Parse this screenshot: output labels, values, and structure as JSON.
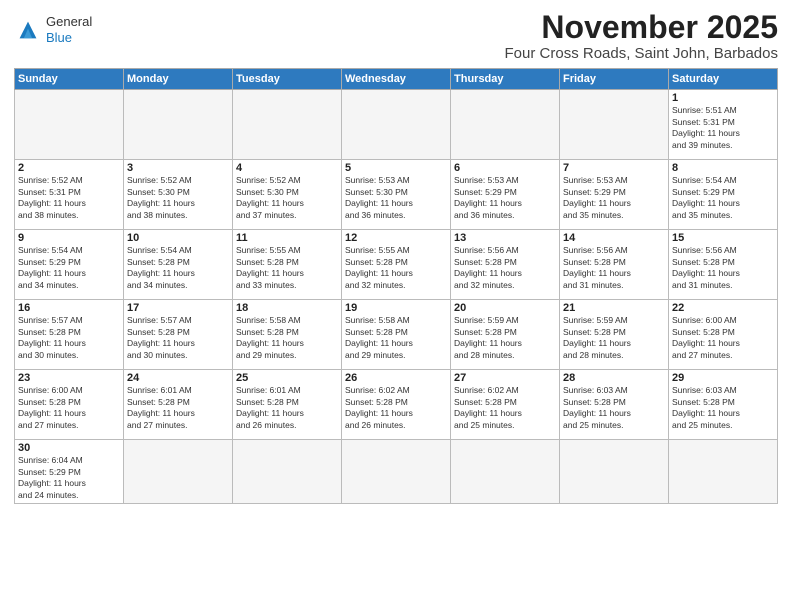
{
  "header": {
    "logo_general": "General",
    "logo_blue": "Blue",
    "month_year": "November 2025",
    "location": "Four Cross Roads, Saint John, Barbados"
  },
  "weekdays": [
    "Sunday",
    "Monday",
    "Tuesday",
    "Wednesday",
    "Thursday",
    "Friday",
    "Saturday"
  ],
  "weeks": [
    [
      {
        "day": "",
        "info": ""
      },
      {
        "day": "",
        "info": ""
      },
      {
        "day": "",
        "info": ""
      },
      {
        "day": "",
        "info": ""
      },
      {
        "day": "",
        "info": ""
      },
      {
        "day": "",
        "info": ""
      },
      {
        "day": "1",
        "info": "Sunrise: 5:51 AM\nSunset: 5:31 PM\nDaylight: 11 hours\nand 39 minutes."
      }
    ],
    [
      {
        "day": "2",
        "info": "Sunrise: 5:52 AM\nSunset: 5:31 PM\nDaylight: 11 hours\nand 38 minutes."
      },
      {
        "day": "3",
        "info": "Sunrise: 5:52 AM\nSunset: 5:30 PM\nDaylight: 11 hours\nand 38 minutes."
      },
      {
        "day": "4",
        "info": "Sunrise: 5:52 AM\nSunset: 5:30 PM\nDaylight: 11 hours\nand 37 minutes."
      },
      {
        "day": "5",
        "info": "Sunrise: 5:53 AM\nSunset: 5:30 PM\nDaylight: 11 hours\nand 36 minutes."
      },
      {
        "day": "6",
        "info": "Sunrise: 5:53 AM\nSunset: 5:29 PM\nDaylight: 11 hours\nand 36 minutes."
      },
      {
        "day": "7",
        "info": "Sunrise: 5:53 AM\nSunset: 5:29 PM\nDaylight: 11 hours\nand 35 minutes."
      },
      {
        "day": "8",
        "info": "Sunrise: 5:54 AM\nSunset: 5:29 PM\nDaylight: 11 hours\nand 35 minutes."
      }
    ],
    [
      {
        "day": "9",
        "info": "Sunrise: 5:54 AM\nSunset: 5:29 PM\nDaylight: 11 hours\nand 34 minutes."
      },
      {
        "day": "10",
        "info": "Sunrise: 5:54 AM\nSunset: 5:28 PM\nDaylight: 11 hours\nand 34 minutes."
      },
      {
        "day": "11",
        "info": "Sunrise: 5:55 AM\nSunset: 5:28 PM\nDaylight: 11 hours\nand 33 minutes."
      },
      {
        "day": "12",
        "info": "Sunrise: 5:55 AM\nSunset: 5:28 PM\nDaylight: 11 hours\nand 32 minutes."
      },
      {
        "day": "13",
        "info": "Sunrise: 5:56 AM\nSunset: 5:28 PM\nDaylight: 11 hours\nand 32 minutes."
      },
      {
        "day": "14",
        "info": "Sunrise: 5:56 AM\nSunset: 5:28 PM\nDaylight: 11 hours\nand 31 minutes."
      },
      {
        "day": "15",
        "info": "Sunrise: 5:56 AM\nSunset: 5:28 PM\nDaylight: 11 hours\nand 31 minutes."
      }
    ],
    [
      {
        "day": "16",
        "info": "Sunrise: 5:57 AM\nSunset: 5:28 PM\nDaylight: 11 hours\nand 30 minutes."
      },
      {
        "day": "17",
        "info": "Sunrise: 5:57 AM\nSunset: 5:28 PM\nDaylight: 11 hours\nand 30 minutes."
      },
      {
        "day": "18",
        "info": "Sunrise: 5:58 AM\nSunset: 5:28 PM\nDaylight: 11 hours\nand 29 minutes."
      },
      {
        "day": "19",
        "info": "Sunrise: 5:58 AM\nSunset: 5:28 PM\nDaylight: 11 hours\nand 29 minutes."
      },
      {
        "day": "20",
        "info": "Sunrise: 5:59 AM\nSunset: 5:28 PM\nDaylight: 11 hours\nand 28 minutes."
      },
      {
        "day": "21",
        "info": "Sunrise: 5:59 AM\nSunset: 5:28 PM\nDaylight: 11 hours\nand 28 minutes."
      },
      {
        "day": "22",
        "info": "Sunrise: 6:00 AM\nSunset: 5:28 PM\nDaylight: 11 hours\nand 27 minutes."
      }
    ],
    [
      {
        "day": "23",
        "info": "Sunrise: 6:00 AM\nSunset: 5:28 PM\nDaylight: 11 hours\nand 27 minutes."
      },
      {
        "day": "24",
        "info": "Sunrise: 6:01 AM\nSunset: 5:28 PM\nDaylight: 11 hours\nand 27 minutes."
      },
      {
        "day": "25",
        "info": "Sunrise: 6:01 AM\nSunset: 5:28 PM\nDaylight: 11 hours\nand 26 minutes."
      },
      {
        "day": "26",
        "info": "Sunrise: 6:02 AM\nSunset: 5:28 PM\nDaylight: 11 hours\nand 26 minutes."
      },
      {
        "day": "27",
        "info": "Sunrise: 6:02 AM\nSunset: 5:28 PM\nDaylight: 11 hours\nand 25 minutes."
      },
      {
        "day": "28",
        "info": "Sunrise: 6:03 AM\nSunset: 5:28 PM\nDaylight: 11 hours\nand 25 minutes."
      },
      {
        "day": "29",
        "info": "Sunrise: 6:03 AM\nSunset: 5:28 PM\nDaylight: 11 hours\nand 25 minutes."
      }
    ],
    [
      {
        "day": "30",
        "info": "Sunrise: 6:04 AM\nSunset: 5:29 PM\nDaylight: 11 hours\nand 24 minutes."
      },
      {
        "day": "",
        "info": ""
      },
      {
        "day": "",
        "info": ""
      },
      {
        "day": "",
        "info": ""
      },
      {
        "day": "",
        "info": ""
      },
      {
        "day": "",
        "info": ""
      },
      {
        "day": "",
        "info": ""
      }
    ]
  ]
}
